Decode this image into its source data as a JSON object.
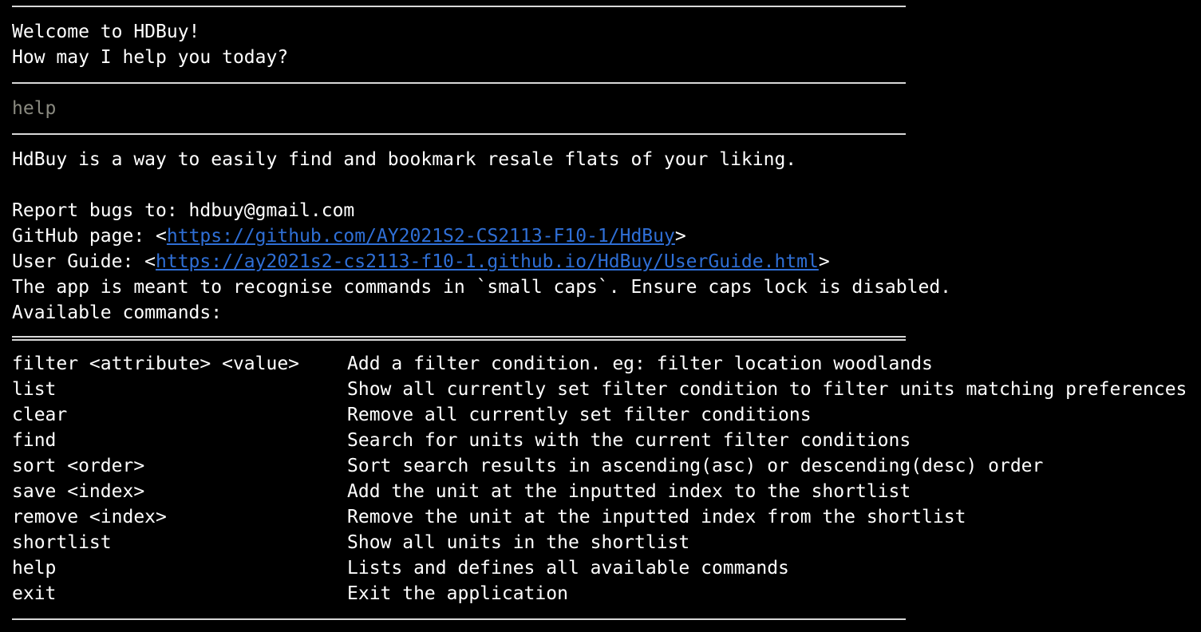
{
  "welcome": {
    "line1": "Welcome to HDBuy!",
    "line2": "How may I help you today?"
  },
  "user_input": "help",
  "help": {
    "intro": "HdBuy is a way to easily find and bookmark resale flats of your liking.",
    "report_bugs": "Report bugs to: hdbuy@gmail.com",
    "github_label": "GitHub page: <",
    "github_url": "https://github.com/AY2021S2-CS2113-F10-1/HdBuy",
    "user_guide_label": "User Guide: <",
    "user_guide_url": "https://ay2021s2-cs2113-f10-1.github.io/HdBuy/UserGuide.html",
    "close_bracket": ">",
    "note": "The app is meant to recognise commands in `small caps`. Ensure caps lock is disabled.",
    "available": "Available commands:"
  },
  "commands": [
    {
      "command": "filter <attribute> <value>",
      "description": "Add a filter condition. eg: filter location woodlands"
    },
    {
      "command": "list",
      "description": "Show all currently set filter condition to filter units matching preferences"
    },
    {
      "command": "clear",
      "description": "Remove all currently set filter conditions"
    },
    {
      "command": "find",
      "description": "Search for units with the current filter conditions"
    },
    {
      "command": "sort <order>",
      "description": "Sort search results in ascending(asc) or descending(desc) order"
    },
    {
      "command": "save <index>",
      "description": "Add the unit at the inputted index to the shortlist"
    },
    {
      "command": "remove <index>",
      "description": "Remove the unit at the inputted index from the shortlist"
    },
    {
      "command": "shortlist",
      "description": "Show all units in the shortlist"
    },
    {
      "command": "help",
      "description": "Lists and defines all available commands"
    },
    {
      "command": "exit",
      "description": "Exit the application"
    }
  ],
  "colors": {
    "background": "#000000",
    "text": "#ffffff",
    "input_text": "#8a8a80",
    "link": "#2f6fd6"
  }
}
